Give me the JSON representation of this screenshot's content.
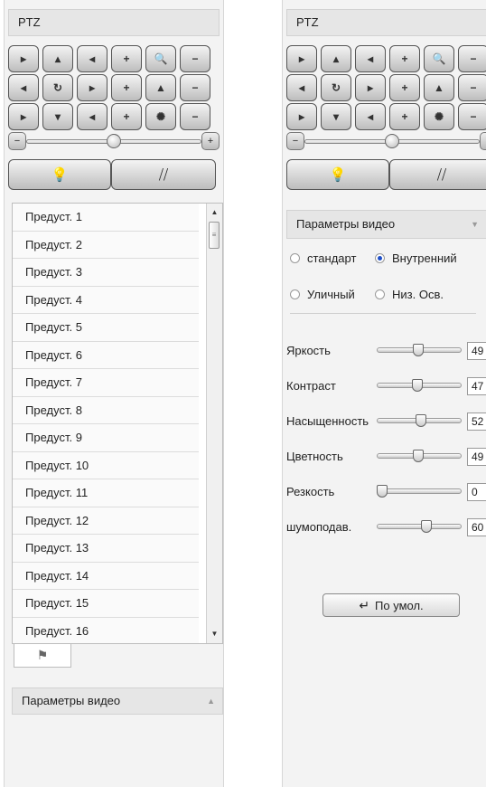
{
  "ptz_panel": {
    "title": "PTZ",
    "buttons": [
      {
        "glyph": "▸"
      },
      {
        "glyph": "▴"
      },
      {
        "glyph": "◂"
      },
      {
        "glyph": "+"
      },
      {
        "glyph": "🔍"
      },
      {
        "glyph": "−"
      },
      {
        "glyph": "◂"
      },
      {
        "glyph": "↻"
      },
      {
        "glyph": "▸"
      },
      {
        "glyph": "+"
      },
      {
        "glyph": "▲"
      },
      {
        "glyph": "−"
      },
      {
        "glyph": "▸"
      },
      {
        "glyph": "▾"
      },
      {
        "glyph": "◂"
      },
      {
        "glyph": "+"
      },
      {
        "glyph": "✺"
      },
      {
        "glyph": "−"
      }
    ],
    "speed_slider": {
      "minus": "−",
      "plus": "+",
      "value": 0.5
    },
    "light_icon": "💡",
    "wiper_icon": "⧸⧸"
  },
  "presets": {
    "items": [
      "Предуст. 1",
      "Предуст. 2",
      "Предуст. 3",
      "Предуст. 4",
      "Предуст. 5",
      "Предуст. 6",
      "Предуст. 7",
      "Предуст. 8",
      "Предуст. 9",
      "Предуст. 10",
      "Предуст. 11",
      "Предуст. 12",
      "Предуст. 13",
      "Предуст. 14",
      "Предуст. 15",
      "Предуст. 16"
    ],
    "tab_icon": "⚑"
  },
  "video_params": {
    "title": "Параметры видео",
    "modes": [
      {
        "label": "стандарт",
        "selected": false
      },
      {
        "label": "Внутренний",
        "selected": true
      },
      {
        "label": "Уличный",
        "selected": false
      },
      {
        "label": "Низ. Осв.",
        "selected": false
      }
    ],
    "params": [
      {
        "label": "Яркость",
        "value": 49
      },
      {
        "label": "Контраст",
        "value": 47
      },
      {
        "label": "Насыщенность",
        "value": 52
      },
      {
        "label": "Цветность",
        "value": 49
      },
      {
        "label": "Резкость",
        "value": 0
      },
      {
        "label": "шумоподав.",
        "value": 60
      }
    ],
    "default_button": "По умол."
  }
}
